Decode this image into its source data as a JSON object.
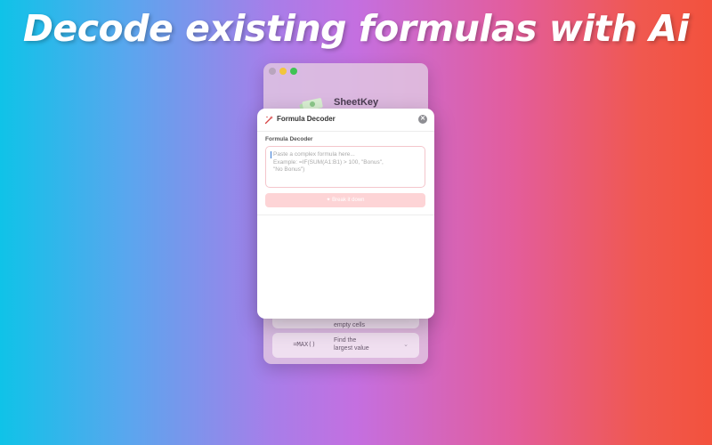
{
  "headline": "Decode existing formulas with Ai",
  "background_window": {
    "app_title": "SheetKey",
    "rows": [
      {
        "formula": "",
        "description": "empty cells"
      },
      {
        "formula": "=MAX()",
        "description": "Find the\nlargest value",
        "chevron": "⌄"
      }
    ]
  },
  "decoder": {
    "title": "Formula Decoder",
    "close_symbol": "✕",
    "section_label": "Formula Decoder",
    "input": {
      "value": "",
      "placeholder": "Paste a complex formula here...\nExample: =IF(SUM(A1:B1) > 100, \"Bonus\",\n\"No Bonus\")"
    },
    "decode_button": "✦ Break it down"
  },
  "colors": {
    "gradient_start": "#0fc3e8",
    "gradient_mid": "#c46fe0",
    "gradient_end": "#f3523d",
    "button_disabled": "#fdd4d6"
  }
}
